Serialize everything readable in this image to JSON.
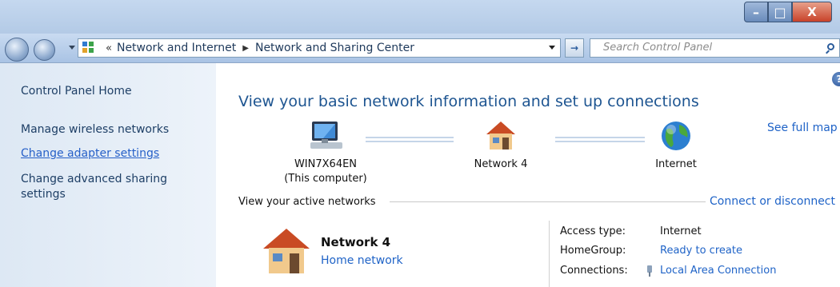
{
  "window": {
    "minimize_glyph": "–",
    "maximize_glyph": "□",
    "close_glyph": "X"
  },
  "address": {
    "overflow": "«",
    "crumbs": [
      "Network and Internet",
      "Network and Sharing Center"
    ],
    "separator": "▶"
  },
  "search": {
    "placeholder": "Search Control Panel"
  },
  "sidebar": {
    "home": "Control Panel Home",
    "items": [
      "Manage wireless networks",
      "Change adapter settings",
      "Change advanced sharing",
      "settings"
    ]
  },
  "main": {
    "title": "View your basic network information and set up connections",
    "see_full_map": "See full map",
    "map": {
      "computer_name": "WIN7X64EN",
      "computer_sub": "(This computer)",
      "network": "Network 4",
      "internet": "Internet"
    },
    "active_networks_heading": "View your active networks",
    "connect_disconnect": "Connect or disconnect",
    "network_card": {
      "name": "Network 4",
      "type": "Home network"
    },
    "details": {
      "access_type_label": "Access type:",
      "access_type_value": "Internet",
      "homegroup_label": "HomeGroup:",
      "homegroup_value": "Ready to create",
      "connections_label": "Connections:",
      "connections_value": "Local Area Connection"
    }
  },
  "colors": {
    "link": "#2660c8",
    "title": "#1e5591"
  },
  "icons": [
    "back-arrow-icon",
    "forward-arrow-icon",
    "control-panel-icon",
    "refresh-icon",
    "search-icon",
    "help-icon",
    "computer-icon",
    "house-icon",
    "globe-icon",
    "network-adapter-icon"
  ]
}
